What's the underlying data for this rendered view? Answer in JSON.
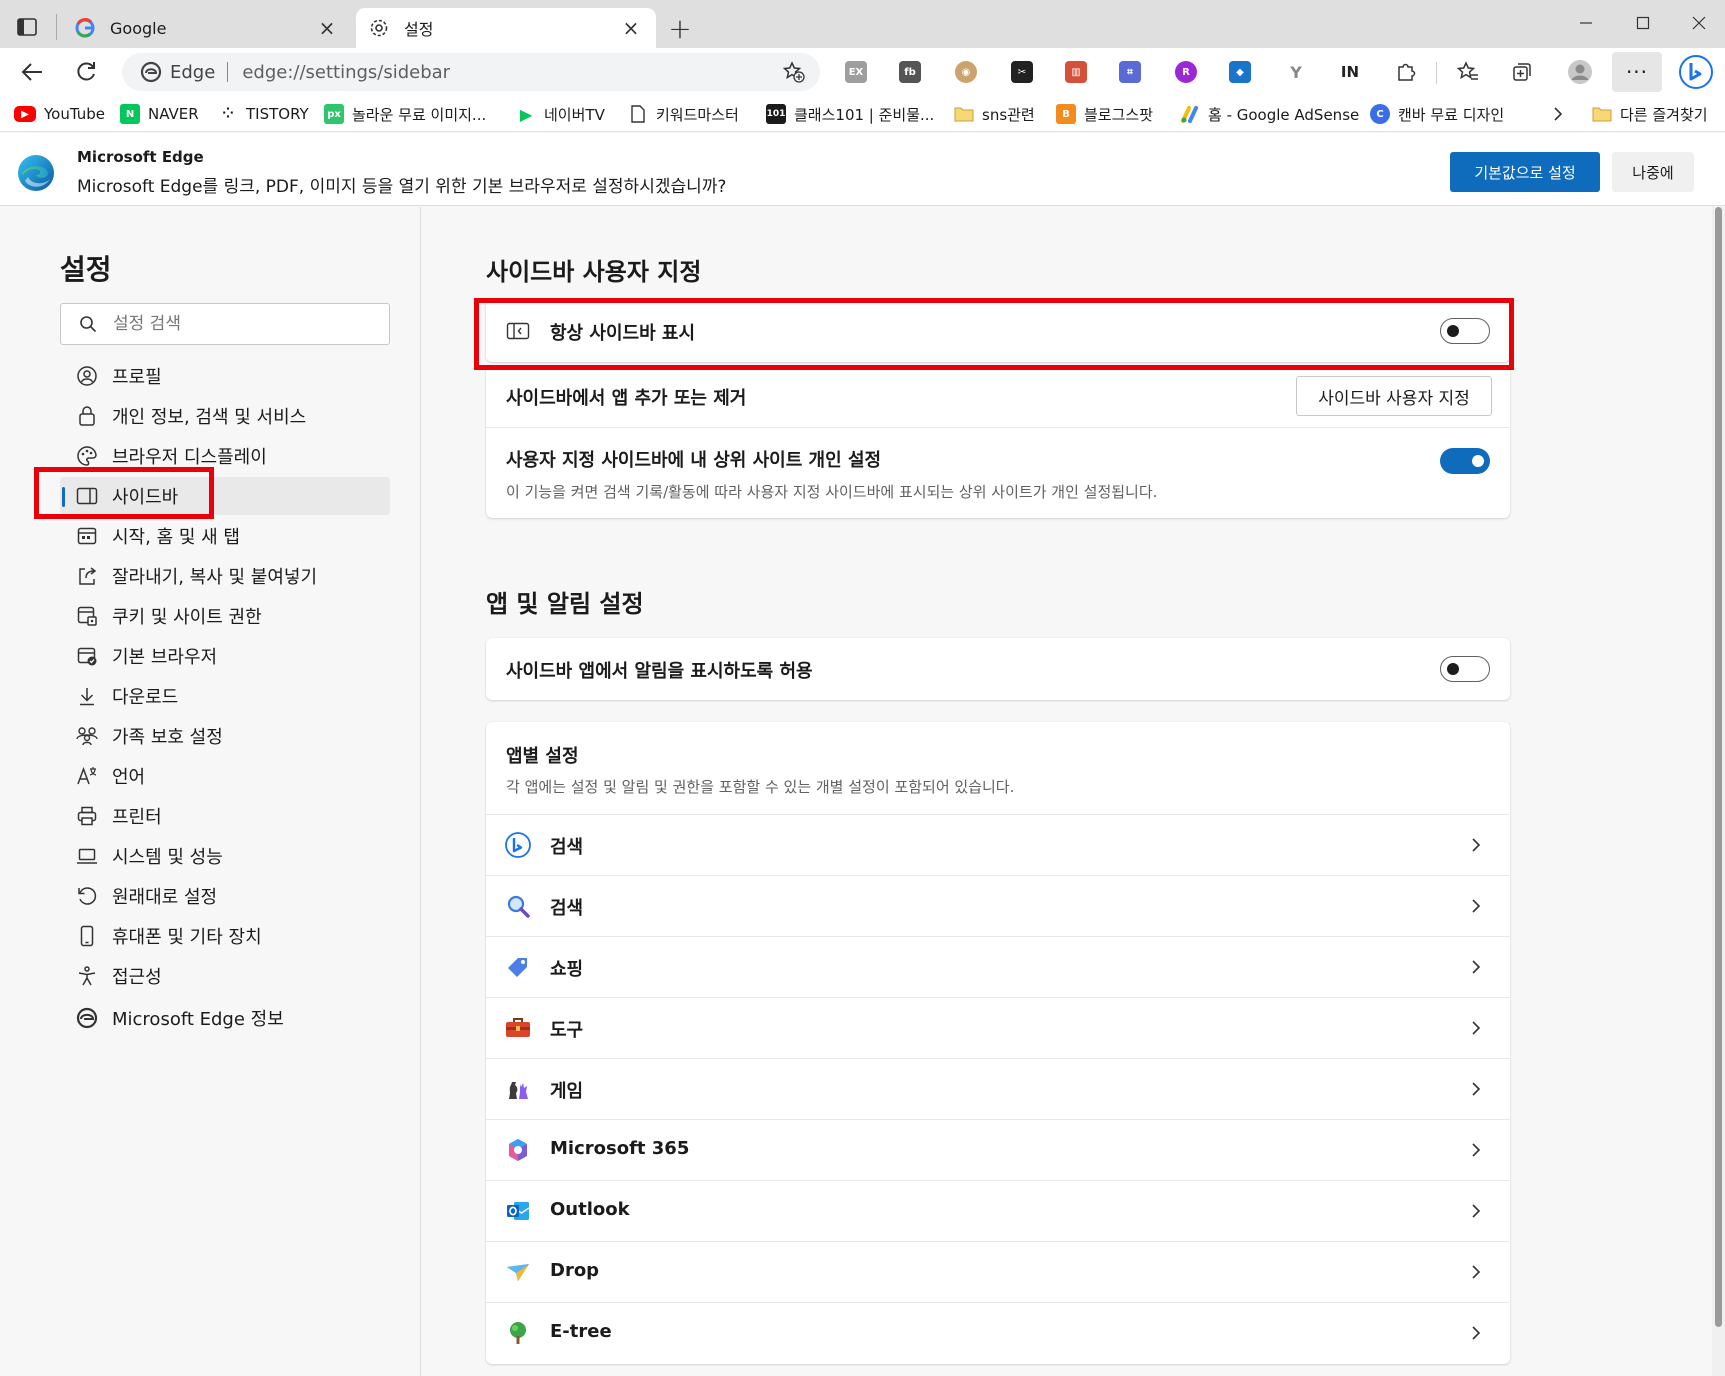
{
  "tabs": [
    {
      "title": "Google",
      "favicon": "google-g-icon"
    },
    {
      "title": "설정",
      "favicon": "gear-icon"
    }
  ],
  "address": {
    "label": "Edge",
    "url": "edge://settings/sidebar"
  },
  "bookmarks": [
    {
      "label": "YouTube",
      "icon": "youtube-icon",
      "color": "#ff0000"
    },
    {
      "label": "NAVER",
      "icon": "naver-icon",
      "color": "#03c75a"
    },
    {
      "label": "TISTORY",
      "icon": "tistory-icon",
      "color": "#1b1b1b"
    },
    {
      "label": "놀라운 무료 이미지...",
      "icon": "pixabay-icon",
      "color": "#2ec66d"
    },
    {
      "label": "네이버TV",
      "icon": "naver-tv-icon",
      "color": "#03c75a"
    },
    {
      "label": "키워드마스터",
      "icon": "page-icon",
      "color": "#1b1b1b"
    },
    {
      "label": "클래스101 | 준비물...",
      "icon": "class101-icon",
      "color": "#1b1b1b"
    },
    {
      "label": "sns관련",
      "icon": "folder-icon",
      "color": "#e8b84a"
    },
    {
      "label": "블로그스팟",
      "icon": "blogger-icon",
      "color": "#f38b1d"
    },
    {
      "label": "홈 - Google AdSense",
      "icon": "adsense-icon",
      "color": "#fbbc04"
    },
    {
      "label": "캔바 무료 디자인",
      "icon": "canva-icon",
      "color": "#3a6ee8"
    }
  ],
  "bookmarks_other": "다른 즐겨찾기",
  "infobar": {
    "title": "Microsoft Edge",
    "message": "Microsoft Edge를 링크, PDF, 이미지 등을 열기 위한 기본 브라우저로 설정하시겠습니까?",
    "primary_button": "기본값으로 설정",
    "secondary_button": "나중에"
  },
  "settings": {
    "title": "설정",
    "search_placeholder": "설정 검색",
    "nav": [
      {
        "label": "프로필",
        "icon": "profile-icon"
      },
      {
        "label": "개인 정보, 검색 및 서비스",
        "icon": "lock-icon"
      },
      {
        "label": "브라우저 디스플레이",
        "icon": "palette-icon"
      },
      {
        "label": "사이드바",
        "icon": "sidebar-icon",
        "selected": true
      },
      {
        "label": "시작, 홈 및 새 탭",
        "icon": "home-grid-icon"
      },
      {
        "label": "잘라내기, 복사 및 붙여넣기",
        "icon": "share-icon"
      },
      {
        "label": "쿠키 및 사이트 권한",
        "icon": "cookie-icon"
      },
      {
        "label": "기본 브라우저",
        "icon": "default-browser-icon"
      },
      {
        "label": "다운로드",
        "icon": "download-icon"
      },
      {
        "label": "가족 보호 설정",
        "icon": "family-icon"
      },
      {
        "label": "언어",
        "icon": "language-icon"
      },
      {
        "label": "프린터",
        "icon": "printer-icon"
      },
      {
        "label": "시스템 및 성능",
        "icon": "laptop-icon"
      },
      {
        "label": "원래대로 설정",
        "icon": "reset-icon"
      },
      {
        "label": "휴대폰 및 기타 장치",
        "icon": "phone-icon"
      },
      {
        "label": "접근성",
        "icon": "accessibility-icon"
      },
      {
        "label": "Microsoft Edge 정보",
        "icon": "edge-logo-icon"
      }
    ]
  },
  "sidebar_section": {
    "title": "사이드바 사용자 지정",
    "always_show": {
      "label": "항상 사이드바 표시",
      "enabled": false
    },
    "add_remove": {
      "label": "사이드바에서 앱 추가 또는 제거",
      "button": "사이드바 사용자 지정"
    },
    "personalize": {
      "label": "사용자 지정 사이드바에 내 상위 사이트 개인 설정",
      "sub": "이 기능을 켜면 검색 기록/활동에 따라 사용자 지정 사이드바에 표시되는 상위 사이트가 개인 설정됩니다.",
      "enabled": true
    }
  },
  "apps_section": {
    "title": "앱 및 알림 설정",
    "notifications": {
      "label": "사이드바 앱에서 알림을 표시하도록 허용",
      "enabled": false
    },
    "per_app": {
      "title": "앱별 설정",
      "sub": "각 앱에는 설정 및 알림 및 권한을 포함할 수 있는 개별 설정이 포함되어 있습니다."
    },
    "apps": [
      {
        "name": "검색",
        "icon": "bing-icon"
      },
      {
        "name": "검색",
        "icon": "magnifier-icon"
      },
      {
        "name": "쇼핑",
        "icon": "shopping-tag-icon"
      },
      {
        "name": "도구",
        "icon": "toolbox-icon"
      },
      {
        "name": "게임",
        "icon": "chess-icon"
      },
      {
        "name": "Microsoft 365",
        "icon": "m365-icon"
      },
      {
        "name": "Outlook",
        "icon": "outlook-icon"
      },
      {
        "name": "Drop",
        "icon": "drop-icon"
      },
      {
        "name": "E-tree",
        "icon": "tree-icon"
      }
    ]
  },
  "colors": {
    "accent": "#0f6cbd",
    "highlight": "#e8000b"
  }
}
